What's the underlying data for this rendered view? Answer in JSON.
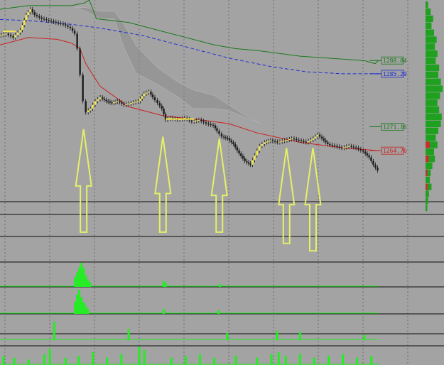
{
  "chart_data": {
    "type": "line",
    "xlim": [
      0,
      530
    ],
    "ylim": [
      1250,
      1305
    ],
    "grid": true,
    "colors": {
      "background": "#a3a3a3",
      "grid": "#6e6e6e",
      "price_up": "#f2e64b",
      "price_down": "#1c1c1c",
      "arrow": "#e6f066",
      "cloud": "#8c8c8c",
      "green_line": "#1b7a1b",
      "blue_line": "#1f2fd0",
      "red_line": "#cc2020"
    },
    "price_labels": [
      {
        "text": "1288.84",
        "value": 1288.84,
        "color": "#1b7a1b"
      },
      {
        "text": "1285.29",
        "value": 1285.29,
        "color": "#1f2fd0"
      },
      {
        "text": "1271.16",
        "value": 1271.16,
        "color": "#1b7a1b"
      },
      {
        "text": "1264.76",
        "value": 1264.76,
        "color": "#cc2020"
      }
    ],
    "series": [
      {
        "role": "green-band",
        "color": "#1b7a1b",
        "x": [
          0,
          40,
          100,
          118,
          125,
          135,
          180,
          240,
          300,
          330,
          360,
          420,
          480,
          510,
          525,
          530
        ],
        "y": [
          1302.5,
          1303.5,
          1303.5,
          1304.2,
          1305,
          1300,
          1299,
          1296,
          1293,
          1292,
          1291.5,
          1290,
          1289.2,
          1288.8,
          1288,
          1288.84
        ]
      },
      {
        "role": "blue-band",
        "color": "#1f2fd0",
        "x": [
          0,
          40,
          100,
          140,
          200,
          260,
          320,
          380,
          430,
          480,
          530
        ],
        "y": [
          1299.8,
          1299.5,
          1298.5,
          1297.5,
          1295.5,
          1292.5,
          1289.5,
          1287.2,
          1285.8,
          1285.3,
          1285.29
        ]
      },
      {
        "role": "red-ma",
        "color": "#cc2020",
        "x": [
          0,
          40,
          80,
          100,
          112,
          120,
          140,
          180,
          230,
          280,
          320,
          360,
          420,
          480,
          530
        ],
        "y": [
          1293,
          1295,
          1294.5,
          1293.5,
          1292,
          1288,
          1282,
          1276.5,
          1274,
          1273,
          1272,
          1269.5,
          1267,
          1265.5,
          1264.76
        ]
      },
      {
        "role": "price",
        "color": "#1c1c1c",
        "x": [
          0,
          10,
          20,
          30,
          38,
          44,
          50,
          60,
          70,
          80,
          90,
          100,
          106,
          110,
          114,
          118,
          122,
          128,
          135,
          142,
          150,
          158,
          166,
          175,
          185,
          195,
          203,
          210,
          215,
          222,
          228,
          233,
          240,
          250,
          260,
          270,
          280,
          290,
          300,
          305,
          312,
          320,
          328,
          336,
          344,
          352,
          358,
          365,
          372,
          380,
          390,
          400,
          410,
          420,
          430,
          440,
          446,
          452,
          460,
          470,
          480,
          490,
          500,
          510,
          518,
          524,
          530
        ],
        "y": [
          1295.5,
          1296,
          1295,
          1297,
          1301,
          1302.5,
          1301,
          1300,
          1299.5,
          1299,
          1298.5,
          1297.5,
          1296,
          1292,
          1285,
          1278,
          1275,
          1276,
          1278,
          1279,
          1278,
          1277.5,
          1278,
          1277,
          1277.5,
          1278,
          1280,
          1280.5,
          1279,
          1277.5,
          1276,
          1273,
          1273.5,
          1273,
          1273.5,
          1272.5,
          1273,
          1272,
          1271.5,
          1270,
          1268.5,
          1268,
          1266.5,
          1264,
          1262,
          1261,
          1263.5,
          1266,
          1267,
          1267.5,
          1267,
          1267.5,
          1268,
          1267.5,
          1267,
          1268,
          1269,
          1268,
          1266.5,
          1266,
          1265.5,
          1266,
          1265.5,
          1264.5,
          1263,
          1261,
          1259.5
        ]
      },
      {
        "role": "cloud-upper",
        "color": "#8c8c8c",
        "x": [
          105,
          120,
          140,
          160,
          172,
          190,
          220,
          250,
          270,
          300,
          320,
          345,
          365
        ],
        "y": [
          1303,
          1303,
          1302,
          1302,
          1299,
          1293,
          1287,
          1283,
          1281,
          1279.5,
          1277,
          1274,
          1272
        ]
      },
      {
        "role": "cloud-lower",
        "color": "#8c8c8c",
        "x": [
          105,
          120,
          140,
          160,
          172,
          190,
          220,
          250,
          270,
          300,
          320,
          345,
          365
        ],
        "y": [
          1303,
          1302,
          1300,
          1300,
          1293,
          1285.5,
          1282.5,
          1279,
          1276,
          1276,
          1275.5,
          1273.5,
          1272
        ]
      }
    ],
    "arrows": [
      {
        "x": 117,
        "tip_y": 1270.5,
        "tail_y": 1243
      },
      {
        "x": 228,
        "tip_y": 1268.5,
        "tail_y": 1243
      },
      {
        "x": 307,
        "tip_y": 1268,
        "tail_y": 1243
      },
      {
        "x": 401,
        "tip_y": 1265.5,
        "tail_y": 1240
      },
      {
        "x": 438,
        "tip_y": 1265.5,
        "tail_y": 1238
      }
    ],
    "horizontal_levels": [
      {
        "value": 1273.2,
        "x_from": 232,
        "x_to": 272,
        "color": "#f2e64b"
      },
      {
        "value": 1296.6,
        "x_from": 4,
        "x_to": 22,
        "color": "#f2e64b"
      }
    ],
    "subpanels": [
      {
        "id": "sub1",
        "type": "bar",
        "color": "#22ee22",
        "x": [
          105,
          108,
          111,
          114,
          117,
          120,
          123,
          126,
          229,
          232,
          308
        ],
        "values": [
          0.4,
          0.6,
          0.8,
          1.0,
          0.8,
          0.5,
          0.3,
          0.2,
          0.25,
          0.15,
          0.12
        ]
      },
      {
        "id": "sub2",
        "type": "bar",
        "color": "#22ee22",
        "x": [
          105,
          108,
          111,
          114,
          117,
          120,
          123,
          229,
          306
        ],
        "values": [
          0.5,
          0.8,
          1.0,
          0.7,
          0.5,
          0.35,
          0.2,
          0.2,
          0.15
        ]
      },
      {
        "id": "sub3",
        "type": "bar",
        "color": "#22ee22",
        "x": [
          76,
          180,
          318,
          388,
          420,
          510
        ],
        "values": [
          1.0,
          0.6,
          0.4,
          0.5,
          0.45,
          0.3
        ]
      },
      {
        "id": "sub4",
        "type": "bar",
        "color": "#22ee22",
        "x": [
          5,
          20,
          40,
          62,
          70,
          92,
          110,
          130,
          150,
          170,
          195,
          202,
          240,
          260,
          280,
          300,
          330,
          360,
          380,
          390,
          400,
          420,
          440,
          460,
          480,
          500,
          520
        ],
        "values": [
          0.5,
          0.4,
          0.3,
          0.6,
          0.9,
          0.4,
          0.5,
          0.7,
          0.4,
          0.6,
          1.0,
          0.8,
          0.4,
          0.5,
          0.6,
          0.4,
          0.5,
          0.4,
          0.6,
          0.7,
          0.5,
          0.6,
          0.4,
          0.5,
          0.6,
          0.4,
          0.5
        ]
      }
    ],
    "volume_profile": {
      "color": "#1fa01f",
      "accent": "#c23030",
      "bins": [
        0.15,
        0.3,
        0.45,
        0.35,
        0.5,
        0.65,
        0.55,
        0.7,
        0.6,
        0.8,
        0.75,
        0.9,
        1.0,
        0.85,
        0.7,
        0.8,
        0.95,
        0.9,
        0.75,
        0.6,
        0.7,
        0.5,
        0.55,
        0.4,
        0.3,
        0.25,
        0.35,
        0.2,
        0.15,
        0.1
      ]
    }
  }
}
